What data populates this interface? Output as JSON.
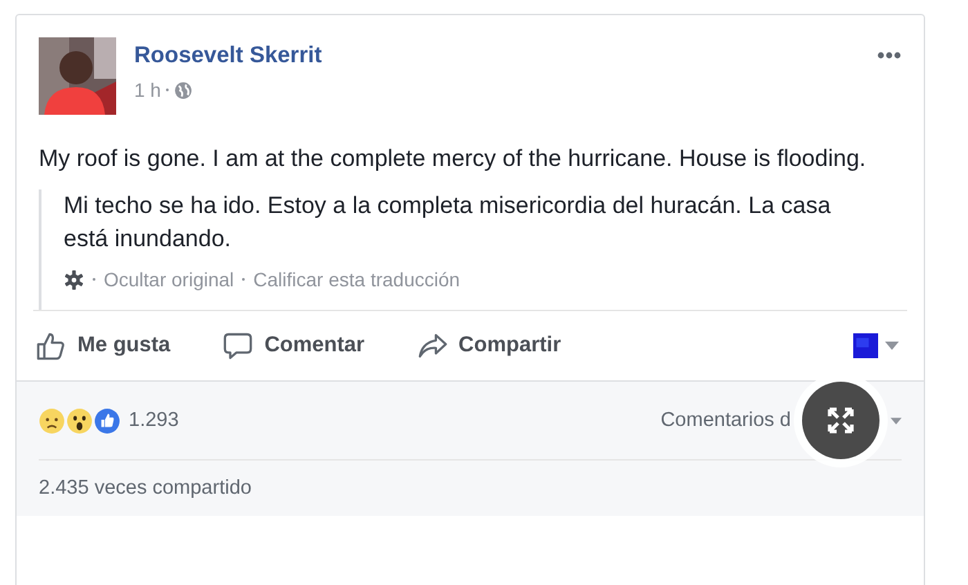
{
  "post": {
    "author": "Roosevelt Skerrit",
    "time": "1 h",
    "text": "My roof is gone. I am at the complete mercy of the hurricane. House is flooding.",
    "translation": {
      "text": "Mi techo se ha ido. Estoy a la completa misericordia del huracán. La casa está inundando.",
      "links": [
        "Ocultar original",
        "Calificar esta traducción"
      ]
    }
  },
  "actions": [
    {
      "kind": "like",
      "label": "Me gusta"
    },
    {
      "kind": "comment",
      "label": "Comentar"
    },
    {
      "kind": "share",
      "label": "Compartir"
    }
  ],
  "reactions": {
    "count": "1.293",
    "sort": "Comentarios d"
  },
  "shares": "2.435 veces compartido"
}
